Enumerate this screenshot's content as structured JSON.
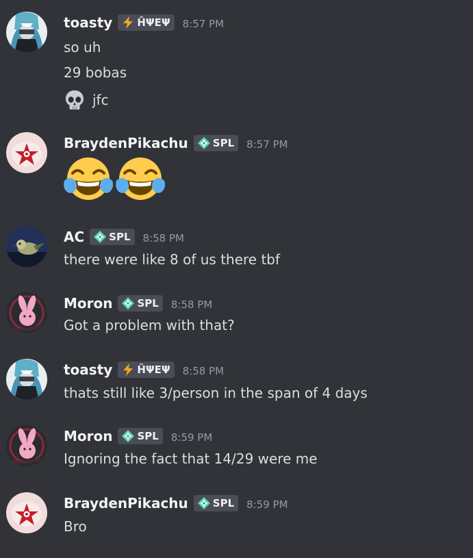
{
  "channel": {
    "messages": [
      {
        "author": "toasty",
        "tag": {
          "icon": "lightning-icon",
          "text": "ĤΨΕΨ",
          "color": "#f5a623"
        },
        "time": "8:57 PM",
        "avatar": "toasty-avatar",
        "lines": [
          "so uh",
          "29 bobas",
          "jfc"
        ],
        "line_emoji": {
          "2": "skull-emoji"
        }
      },
      {
        "author": "BraydenPikachu",
        "tag": {
          "icon": "sparkle-diamond-icon",
          "text": "SPL",
          "color": "#57d5b9"
        },
        "time": "8:57 PM",
        "avatar": "brayden-avatar",
        "jumbo_emoji": [
          "joy-emoji",
          "joy-emoji"
        ]
      },
      {
        "author": "AC",
        "tag": {
          "icon": "sparkle-diamond-icon",
          "text": "SPL",
          "color": "#57d5b9"
        },
        "time": "8:58 PM",
        "avatar": "ac-avatar",
        "lines": [
          "there were like 8 of us there tbf"
        ]
      },
      {
        "author": "Moron",
        "tag": {
          "icon": "sparkle-diamond-icon",
          "text": "SPL",
          "color": "#57d5b9"
        },
        "time": "8:58 PM",
        "avatar": "moron-avatar",
        "lines": [
          "Got a problem with that?"
        ]
      },
      {
        "author": "toasty",
        "tag": {
          "icon": "lightning-icon",
          "text": "ĤΨΕΨ",
          "color": "#f5a623"
        },
        "time": "8:58 PM",
        "avatar": "toasty-avatar",
        "lines": [
          "thats still like 3/person in the span of 4 days"
        ]
      },
      {
        "author": "Moron",
        "tag": {
          "icon": "sparkle-diamond-icon",
          "text": "SPL",
          "color": "#57d5b9"
        },
        "time": "8:59 PM",
        "avatar": "moron-avatar",
        "lines": [
          "Ignoring the fact that 14/29 were me"
        ]
      },
      {
        "author": "BraydenPikachu",
        "tag": {
          "icon": "sparkle-diamond-icon",
          "text": "SPL",
          "color": "#57d5b9"
        },
        "time": "8:59 PM",
        "avatar": "brayden-avatar",
        "lines": [
          "Bro"
        ]
      }
    ]
  },
  "theme": {
    "background": "#313338",
    "username_color": "#f2f3f5",
    "text_color": "#dbdee1",
    "timestamp_color": "#949ba4",
    "tag_background": "#4a4d56"
  }
}
